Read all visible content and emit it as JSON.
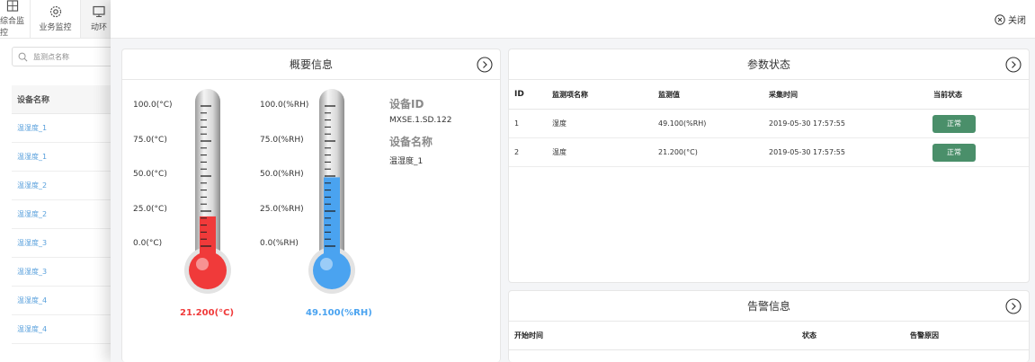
{
  "top_nav": {
    "tabs": [
      {
        "label": "综合监控",
        "icon": "dashboard-icon"
      },
      {
        "label": "业务监控",
        "icon": "gear-icon"
      },
      {
        "label": "动环",
        "icon": "monitor-icon"
      }
    ]
  },
  "sidebar": {
    "search_placeholder": "监测点名称",
    "header": "设备名称",
    "rows": [
      "温湿度_1",
      "温湿度_1",
      "温湿度_2",
      "温湿度_2",
      "温湿度_3",
      "温湿度_3",
      "温湿度_4",
      "温湿度_4"
    ]
  },
  "drawer": {
    "close_label": "关闭",
    "summary": {
      "title": "概要信息",
      "temp_scale": [
        "100.0(°C)",
        "75.0(°C)",
        "50.0(°C)",
        "25.0(°C)",
        "0.0(°C)"
      ],
      "hum_scale": [
        "100.0(%RH)",
        "75.0(%RH)",
        "50.0(%RH)",
        "25.0(%RH)",
        "0.0(%RH)"
      ],
      "temp_reading": "21.200(°C)",
      "hum_reading": "49.100(%RH)",
      "temp_fill_fraction": 0.212,
      "hum_fill_fraction": 0.491,
      "temp_color": "#f03a3a",
      "hum_color": "#4aa3f0",
      "device_id_label": "设备ID",
      "device_id": "MXSE.1.SD.122",
      "device_name_label": "设备名称",
      "device_name": "温湿度_1"
    },
    "params": {
      "title": "参数状态",
      "headers": [
        "ID",
        "监测项名称",
        "监测值",
        "采集时间",
        "当前状态"
      ],
      "rows": [
        {
          "id": "1",
          "name": "湿度",
          "value": "49.100(%RH)",
          "time": "2019-05-30 17:57:55",
          "status": "正常"
        },
        {
          "id": "2",
          "name": "温度",
          "value": "21.200(°C)",
          "time": "2019-05-30 17:57:55",
          "status": "正常"
        }
      ],
      "status_color": "#4a8f6a"
    },
    "alarms": {
      "title": "告警信息",
      "headers": [
        "开始时间",
        "状态",
        "告警原因"
      ]
    }
  }
}
